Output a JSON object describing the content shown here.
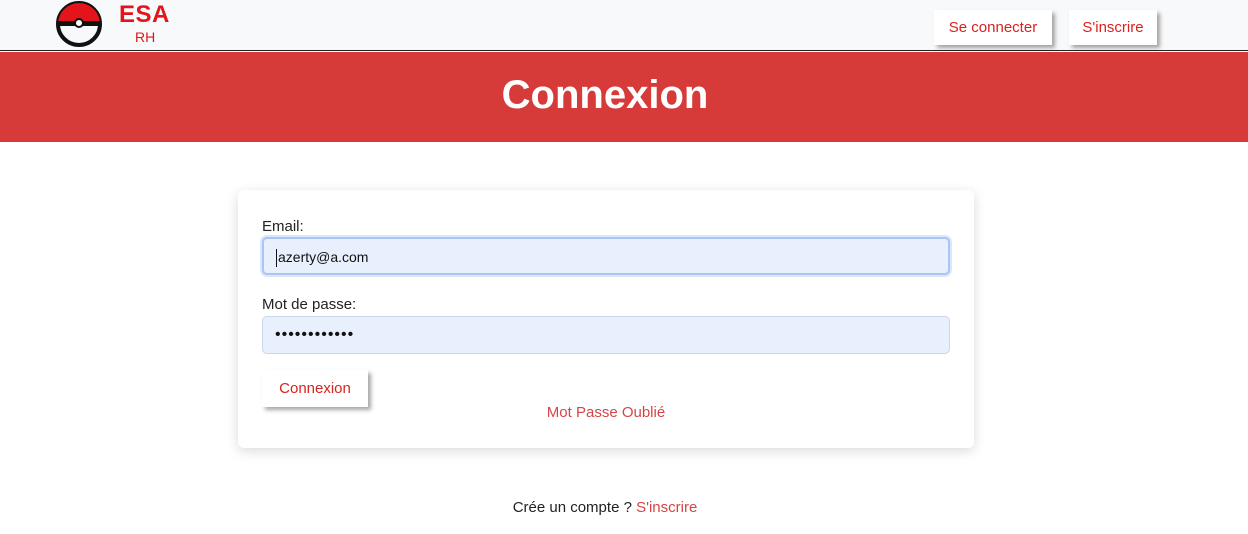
{
  "navbar": {
    "brand": "ESA",
    "brand_sub": "RH",
    "logo_icon": "esa-logo-icon",
    "login_label": "Se connecter",
    "signup_label": "S'inscrire"
  },
  "banner": {
    "title": "Connexion"
  },
  "form": {
    "email_label": "Email:",
    "email_value": "azerty@a.com",
    "password_label": "Mot de passe:",
    "password_value": "••••••••••••",
    "submit_label": "Connexion",
    "forgot_label": "Mot Passe Oublié"
  },
  "footer": {
    "prompt": "Crée un compte ?",
    "signup_link": "S'inscrire"
  },
  "colors": {
    "accent_red": "#d63b3a",
    "link_red": "#d64545",
    "input_bg": "#e8f0fe"
  }
}
